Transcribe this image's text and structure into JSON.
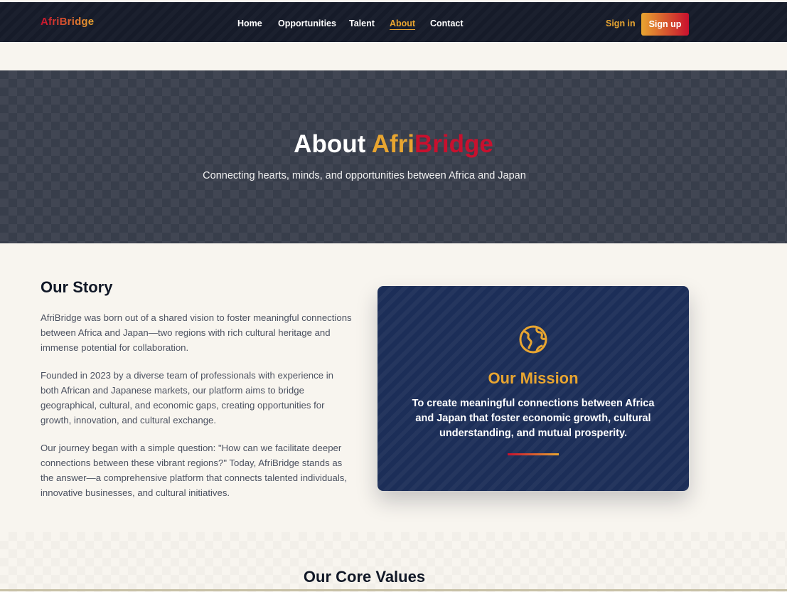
{
  "nav": {
    "brand": "AfriBridge",
    "links": [
      {
        "label": "Home",
        "active": false
      },
      {
        "label": "Opportunities",
        "active": false
      },
      {
        "label": "Talent",
        "active": false
      },
      {
        "label": "About",
        "active": true
      },
      {
        "label": "Contact",
        "active": false
      }
    ],
    "sign_in": "Sign in",
    "sign_up": "Sign up"
  },
  "hero": {
    "title_prefix": "About",
    "title_part_a": "Afri",
    "title_part_b": "Bridge",
    "subtitle": "Connecting hearts, minds, and opportunities between Africa and Japan"
  },
  "story": {
    "title": "Our Story",
    "paragraphs": [
      "AfriBridge was born out of a shared vision to foster meaningful connections between Africa and Japan—two regions with rich cultural heritage and immense potential for collaboration.",
      "Founded in 2023 by a diverse team of professionals with experience in both African and Japanese markets, our platform aims to bridge geographical, cultural, and economic gaps, creating opportunities for growth, innovation, and cultural exchange.",
      "Our journey began with a simple question: \"How can we facilitate deeper connections between these vibrant regions?\" Today, AfriBridge stands as the answer—a comprehensive platform that connects talented individuals, innovative businesses, and cultural initiatives."
    ]
  },
  "mission": {
    "icon": "globe-icon",
    "title": "Our Mission",
    "text": "To create meaningful connections between Africa and Japan that foster economic growth, cultural understanding, and mutual prosperity."
  },
  "values": {
    "title": "Our Core Values"
  },
  "colors": {
    "gold": "#e8a530",
    "red": "#c8102e",
    "navy": "#1c2e58",
    "dark": "#161b29",
    "cream": "#f8f5ef"
  }
}
